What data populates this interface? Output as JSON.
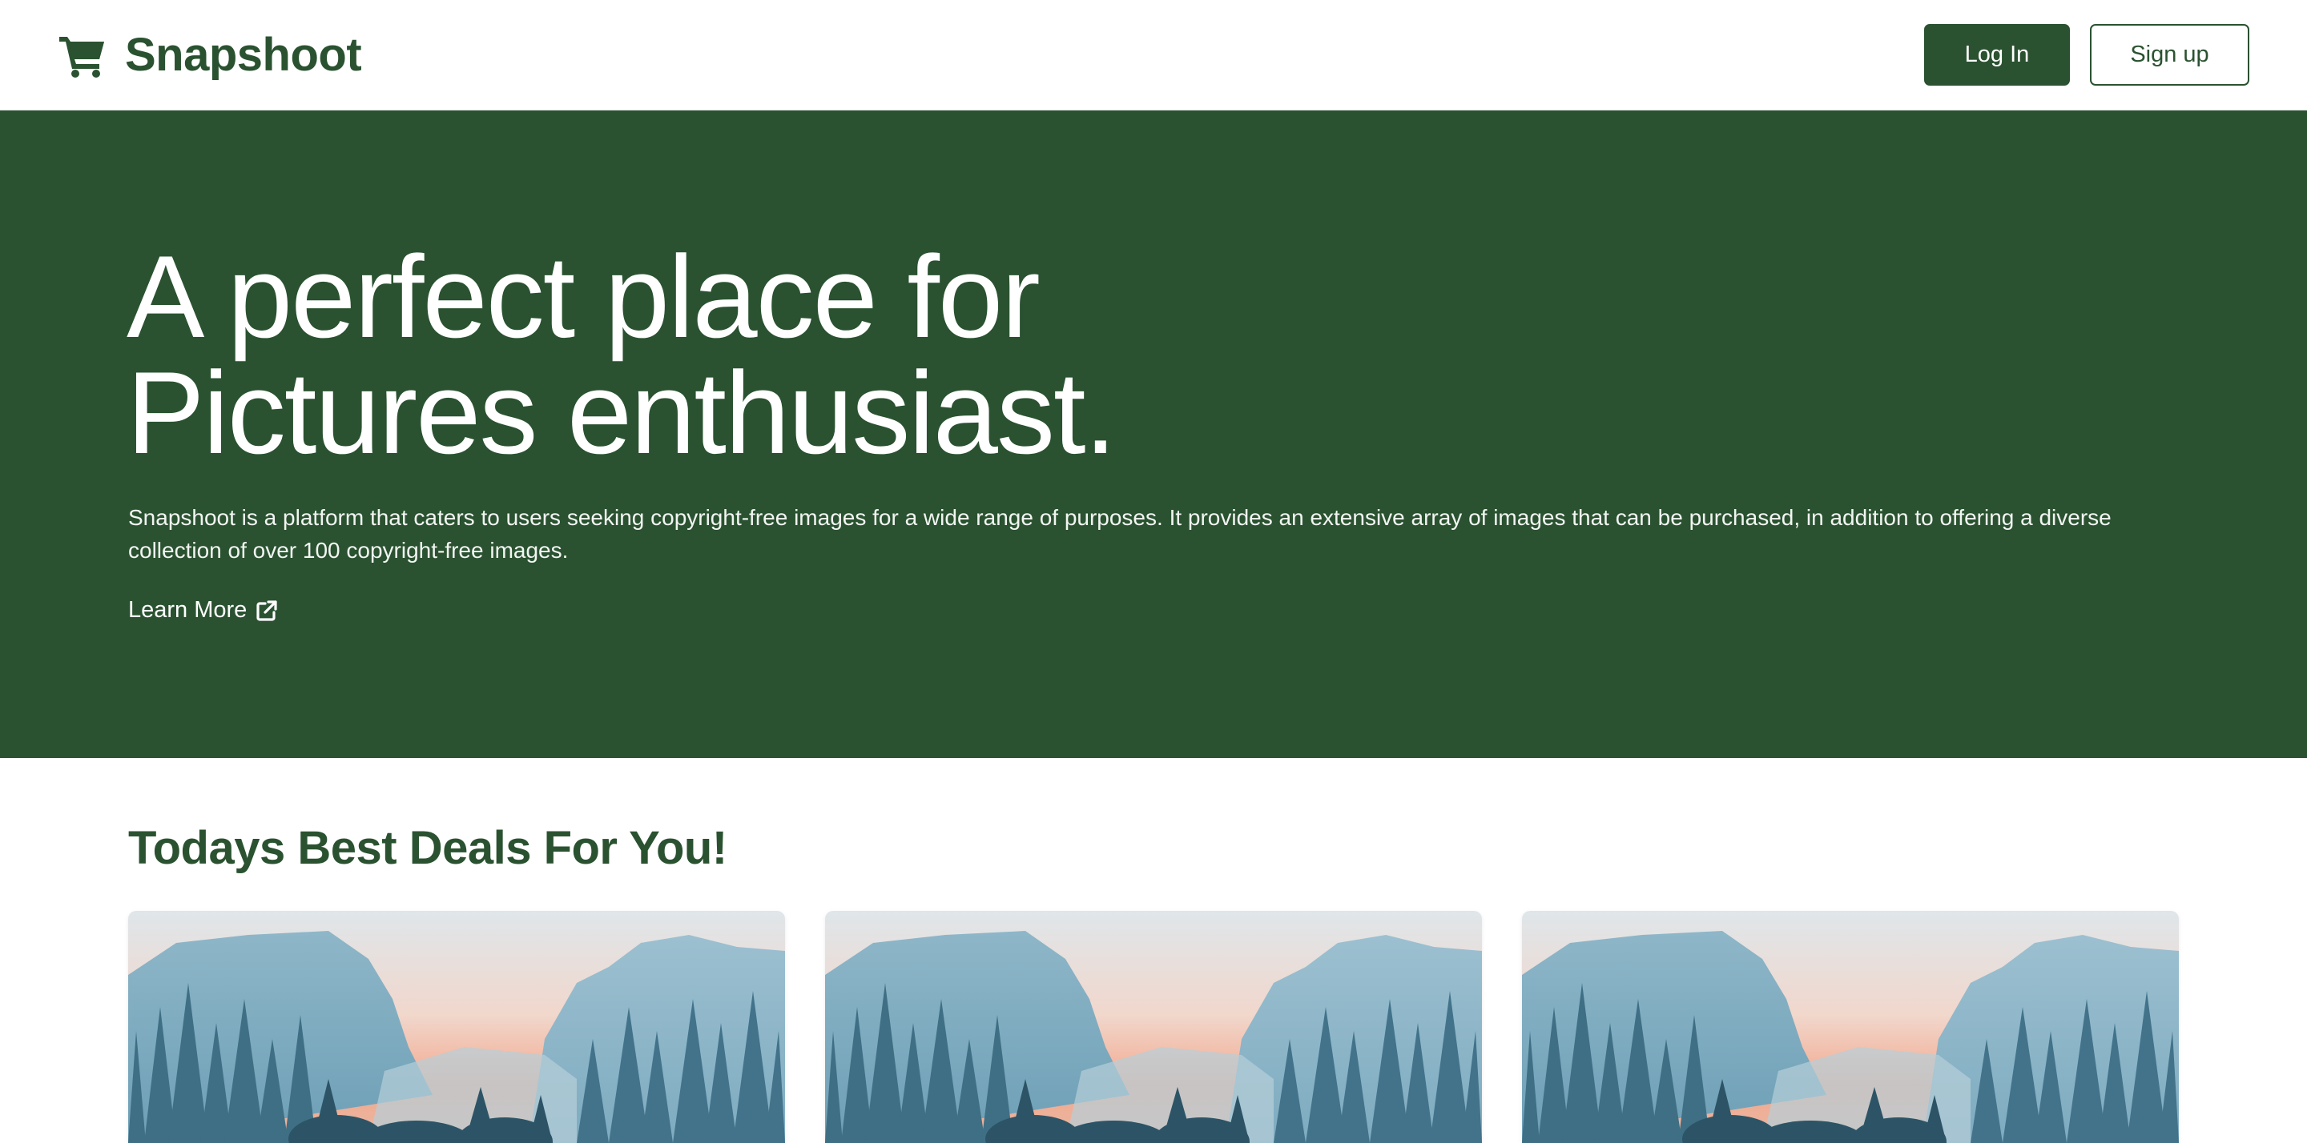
{
  "navbar": {
    "brand_name": "Snapshoot",
    "brand_icon": "shopping-cart-icon",
    "login_label": "Log In",
    "signup_label": "Sign up"
  },
  "hero": {
    "title_line1": "A perfect place for",
    "title_line2": "Pictures enthusiast.",
    "description": "Snapshoot is a platform that caters to users seeking copyright-free images for a wide range of purposes. It provides an extensive array of images that can be purchased, in addition to offering a diverse collection of over 100 copyright-free images.",
    "learn_more_label": "Learn More",
    "learn_more_icon": "external-link-icon"
  },
  "deals": {
    "title": "Todays Best Deals For You!",
    "cards": [
      {
        "image": "mountain-forest-landscape"
      },
      {
        "image": "mountain-forest-landscape"
      },
      {
        "image": "mountain-forest-landscape"
      }
    ]
  },
  "colors": {
    "brand_green": "#2a5230",
    "white": "#ffffff"
  }
}
